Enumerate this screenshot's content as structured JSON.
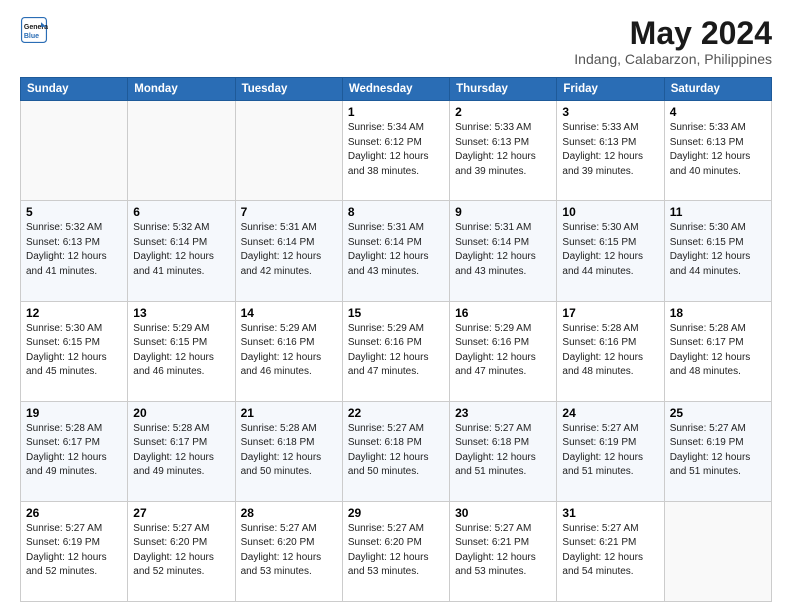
{
  "logo": {
    "line1": "General",
    "line2": "Blue"
  },
  "title": "May 2024",
  "subtitle": "Indang, Calabarzon, Philippines",
  "weekdays": [
    "Sunday",
    "Monday",
    "Tuesday",
    "Wednesday",
    "Thursday",
    "Friday",
    "Saturday"
  ],
  "weeks": [
    [
      {
        "day": "",
        "info": ""
      },
      {
        "day": "",
        "info": ""
      },
      {
        "day": "",
        "info": ""
      },
      {
        "day": "1",
        "info": "Sunrise: 5:34 AM\nSunset: 6:12 PM\nDaylight: 12 hours\nand 38 minutes."
      },
      {
        "day": "2",
        "info": "Sunrise: 5:33 AM\nSunset: 6:13 PM\nDaylight: 12 hours\nand 39 minutes."
      },
      {
        "day": "3",
        "info": "Sunrise: 5:33 AM\nSunset: 6:13 PM\nDaylight: 12 hours\nand 39 minutes."
      },
      {
        "day": "4",
        "info": "Sunrise: 5:33 AM\nSunset: 6:13 PM\nDaylight: 12 hours\nand 40 minutes."
      }
    ],
    [
      {
        "day": "5",
        "info": "Sunrise: 5:32 AM\nSunset: 6:13 PM\nDaylight: 12 hours\nand 41 minutes."
      },
      {
        "day": "6",
        "info": "Sunrise: 5:32 AM\nSunset: 6:14 PM\nDaylight: 12 hours\nand 41 minutes."
      },
      {
        "day": "7",
        "info": "Sunrise: 5:31 AM\nSunset: 6:14 PM\nDaylight: 12 hours\nand 42 minutes."
      },
      {
        "day": "8",
        "info": "Sunrise: 5:31 AM\nSunset: 6:14 PM\nDaylight: 12 hours\nand 43 minutes."
      },
      {
        "day": "9",
        "info": "Sunrise: 5:31 AM\nSunset: 6:14 PM\nDaylight: 12 hours\nand 43 minutes."
      },
      {
        "day": "10",
        "info": "Sunrise: 5:30 AM\nSunset: 6:15 PM\nDaylight: 12 hours\nand 44 minutes."
      },
      {
        "day": "11",
        "info": "Sunrise: 5:30 AM\nSunset: 6:15 PM\nDaylight: 12 hours\nand 44 minutes."
      }
    ],
    [
      {
        "day": "12",
        "info": "Sunrise: 5:30 AM\nSunset: 6:15 PM\nDaylight: 12 hours\nand 45 minutes."
      },
      {
        "day": "13",
        "info": "Sunrise: 5:29 AM\nSunset: 6:15 PM\nDaylight: 12 hours\nand 46 minutes."
      },
      {
        "day": "14",
        "info": "Sunrise: 5:29 AM\nSunset: 6:16 PM\nDaylight: 12 hours\nand 46 minutes."
      },
      {
        "day": "15",
        "info": "Sunrise: 5:29 AM\nSunset: 6:16 PM\nDaylight: 12 hours\nand 47 minutes."
      },
      {
        "day": "16",
        "info": "Sunrise: 5:29 AM\nSunset: 6:16 PM\nDaylight: 12 hours\nand 47 minutes."
      },
      {
        "day": "17",
        "info": "Sunrise: 5:28 AM\nSunset: 6:16 PM\nDaylight: 12 hours\nand 48 minutes."
      },
      {
        "day": "18",
        "info": "Sunrise: 5:28 AM\nSunset: 6:17 PM\nDaylight: 12 hours\nand 48 minutes."
      }
    ],
    [
      {
        "day": "19",
        "info": "Sunrise: 5:28 AM\nSunset: 6:17 PM\nDaylight: 12 hours\nand 49 minutes."
      },
      {
        "day": "20",
        "info": "Sunrise: 5:28 AM\nSunset: 6:17 PM\nDaylight: 12 hours\nand 49 minutes."
      },
      {
        "day": "21",
        "info": "Sunrise: 5:28 AM\nSunset: 6:18 PM\nDaylight: 12 hours\nand 50 minutes."
      },
      {
        "day": "22",
        "info": "Sunrise: 5:27 AM\nSunset: 6:18 PM\nDaylight: 12 hours\nand 50 minutes."
      },
      {
        "day": "23",
        "info": "Sunrise: 5:27 AM\nSunset: 6:18 PM\nDaylight: 12 hours\nand 51 minutes."
      },
      {
        "day": "24",
        "info": "Sunrise: 5:27 AM\nSunset: 6:19 PM\nDaylight: 12 hours\nand 51 minutes."
      },
      {
        "day": "25",
        "info": "Sunrise: 5:27 AM\nSunset: 6:19 PM\nDaylight: 12 hours\nand 51 minutes."
      }
    ],
    [
      {
        "day": "26",
        "info": "Sunrise: 5:27 AM\nSunset: 6:19 PM\nDaylight: 12 hours\nand 52 minutes."
      },
      {
        "day": "27",
        "info": "Sunrise: 5:27 AM\nSunset: 6:20 PM\nDaylight: 12 hours\nand 52 minutes."
      },
      {
        "day": "28",
        "info": "Sunrise: 5:27 AM\nSunset: 6:20 PM\nDaylight: 12 hours\nand 53 minutes."
      },
      {
        "day": "29",
        "info": "Sunrise: 5:27 AM\nSunset: 6:20 PM\nDaylight: 12 hours\nand 53 minutes."
      },
      {
        "day": "30",
        "info": "Sunrise: 5:27 AM\nSunset: 6:21 PM\nDaylight: 12 hours\nand 53 minutes."
      },
      {
        "day": "31",
        "info": "Sunrise: 5:27 AM\nSunset: 6:21 PM\nDaylight: 12 hours\nand 54 minutes."
      },
      {
        "day": "",
        "info": ""
      }
    ]
  ]
}
